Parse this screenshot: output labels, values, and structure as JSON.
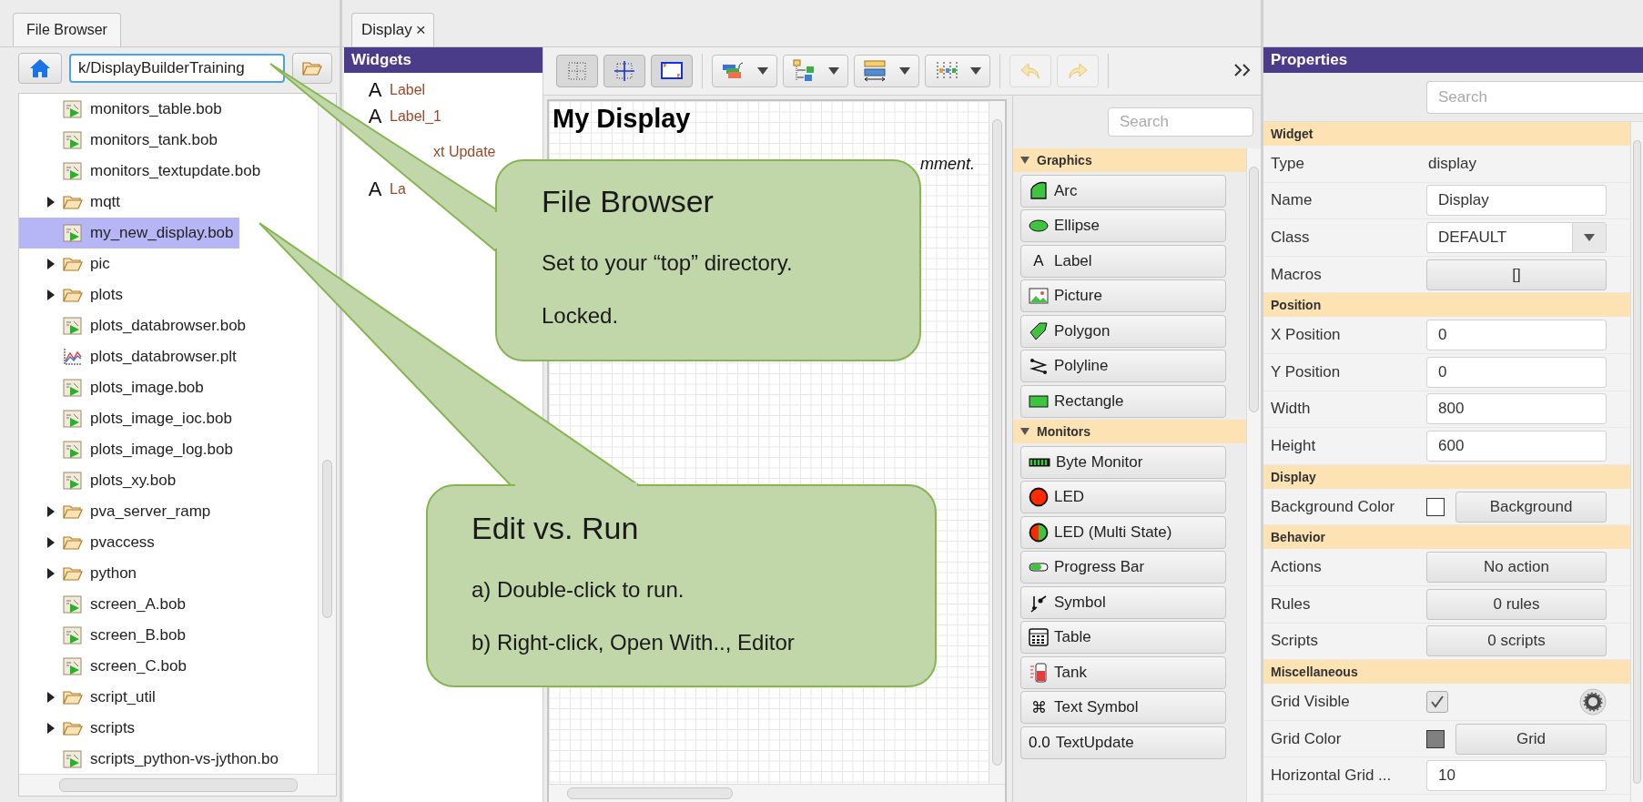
{
  "file_browser": {
    "tab": {
      "label": "File Browser",
      "selected": true
    },
    "path": "k/DisplayBuilderTraining",
    "items": [
      {
        "kind": "display",
        "name": "monitors_table.bob",
        "selected": false
      },
      {
        "kind": "display",
        "name": "monitors_tank.bob",
        "selected": false
      },
      {
        "kind": "display",
        "name": "monitors_textupdate.bob",
        "selected": false
      },
      {
        "kind": "folder",
        "name": "mqtt",
        "expanded": false,
        "selected": false
      },
      {
        "kind": "display",
        "name": "my_new_display.bob",
        "selected": true
      },
      {
        "kind": "folder",
        "name": "pic",
        "expanded": false,
        "selected": false
      },
      {
        "kind": "folder",
        "name": "plots",
        "expanded": false,
        "selected": false
      },
      {
        "kind": "display",
        "name": "plots_databrowser.bob",
        "selected": false
      },
      {
        "kind": "plot",
        "name": "plots_databrowser.plt",
        "selected": false
      },
      {
        "kind": "display",
        "name": "plots_image.bob",
        "selected": false
      },
      {
        "kind": "display",
        "name": "plots_image_ioc.bob",
        "selected": false
      },
      {
        "kind": "display",
        "name": "plots_image_log.bob",
        "selected": false
      },
      {
        "kind": "display",
        "name": "plots_xy.bob",
        "selected": false
      },
      {
        "kind": "folder",
        "name": "pva_server_ramp",
        "expanded": false,
        "selected": false
      },
      {
        "kind": "folder",
        "name": "pvaccess",
        "expanded": false,
        "selected": false
      },
      {
        "kind": "folder",
        "name": "python",
        "expanded": false,
        "selected": false
      },
      {
        "kind": "display",
        "name": "screen_A.bob",
        "selected": false
      },
      {
        "kind": "display",
        "name": "screen_B.bob",
        "selected": false
      },
      {
        "kind": "display",
        "name": "screen_C.bob",
        "selected": false
      },
      {
        "kind": "folder",
        "name": "script_util",
        "expanded": false,
        "selected": false
      },
      {
        "kind": "folder",
        "name": "scripts",
        "expanded": false,
        "selected": false
      },
      {
        "kind": "display",
        "name": "scripts_python-vs-jython.bo",
        "selected": false
      }
    ]
  },
  "editor": {
    "tabs": [
      {
        "label": "Display",
        "close": "×",
        "selected": true
      }
    ],
    "outline": {
      "title": "Widgets",
      "items": [
        {
          "kind": "label",
          "glyph": "A",
          "name": "Label"
        },
        {
          "kind": "label",
          "glyph": "A",
          "name": "Label_1"
        },
        {
          "kind": "text",
          "name": "xt Update"
        },
        {
          "kind": "label",
          "glyph": "A",
          "name": "La"
        }
      ]
    },
    "toolbar": {
      "toggles": [
        {
          "kind": "grid",
          "on": true
        },
        {
          "kind": "snap",
          "on": true
        },
        {
          "kind": "coords",
          "on": true
        }
      ],
      "menus": [
        {
          "kind": "order"
        },
        {
          "kind": "align"
        },
        {
          "kind": "size"
        },
        {
          "kind": "distribute"
        }
      ],
      "undo": {
        "disabled": true
      },
      "redo": {
        "disabled": true
      }
    },
    "canvas": {
      "title": "My Display",
      "comment": "mment."
    },
    "palette": {
      "placeholder": "Search",
      "groups": [
        {
          "name": "Graphics",
          "expanded": true,
          "items": [
            {
              "kind": "arc",
              "name": "Arc"
            },
            {
              "kind": "ellipse",
              "name": "Ellipse"
            },
            {
              "kind": "glyph",
              "glyph": "A",
              "name": "Label"
            },
            {
              "kind": "picture",
              "name": "Picture"
            },
            {
              "kind": "polygon",
              "name": "Polygon"
            },
            {
              "kind": "polyline",
              "name": "Polyline"
            },
            {
              "kind": "rectangle",
              "name": "Rectangle"
            }
          ]
        },
        {
          "name": "Monitors",
          "expanded": true,
          "items": [
            {
              "kind": "byte",
              "name": "Byte Monitor"
            },
            {
              "kind": "led",
              "name": "LED"
            },
            {
              "kind": "multiled",
              "name": "LED (Multi State)"
            },
            {
              "kind": "progress",
              "name": "Progress Bar"
            },
            {
              "kind": "symbol",
              "name": "Symbol"
            },
            {
              "kind": "table",
              "name": "Table"
            },
            {
              "kind": "tank",
              "name": "Tank"
            },
            {
              "kind": "glyph",
              "glyph": "⌘",
              "name": "Text Symbol"
            },
            {
              "kind": "glyph",
              "glyph": "0.0",
              "name": "TextUpdate"
            }
          ]
        }
      ]
    }
  },
  "properties": {
    "title": "Properties",
    "placeholder": "Search",
    "sections": [
      {
        "name": "Widget",
        "rows": [
          {
            "kind": "readonly",
            "label": "Type",
            "value": "display"
          },
          {
            "kind": "text",
            "label": "Name",
            "value": "Display"
          },
          {
            "kind": "combo",
            "label": "Class",
            "value": "DEFAULT"
          },
          {
            "kind": "button",
            "label": "Macros",
            "value": "[]"
          }
        ]
      },
      {
        "name": "Position",
        "rows": [
          {
            "kind": "text",
            "label": "X Position",
            "value": "0"
          },
          {
            "kind": "text",
            "label": "Y Position",
            "value": "0"
          },
          {
            "kind": "text",
            "label": "Width",
            "value": "800"
          },
          {
            "kind": "text",
            "label": "Height",
            "value": "600"
          }
        ]
      },
      {
        "name": "Display",
        "rows": [
          {
            "kind": "color",
            "label": "Background Color",
            "color": "#ffffff",
            "value": "Background"
          }
        ]
      },
      {
        "name": "Behavior",
        "rows": [
          {
            "kind": "button",
            "label": "Actions",
            "value": "No action"
          },
          {
            "kind": "button",
            "label": "Rules",
            "value": "0 rules"
          },
          {
            "kind": "button",
            "label": "Scripts",
            "value": "0 scripts"
          }
        ]
      },
      {
        "name": "Miscellaneous",
        "rows": [
          {
            "kind": "checkbox",
            "label": "Grid Visible",
            "checked": true
          },
          {
            "kind": "color",
            "label": "Grid Color",
            "color": "#808080",
            "value": "Grid"
          },
          {
            "kind": "text",
            "label": "Horizontal Grid ...",
            "value": "10"
          }
        ]
      }
    ]
  },
  "callouts": [
    {
      "title": "File Browser",
      "lines": [
        "Set to your “top” directory.",
        "Locked."
      ]
    },
    {
      "title": "Edit vs. Run",
      "lines": [
        "a) Double-click to run.",
        "b) Right-click, Open With.., Editor"
      ]
    }
  ]
}
